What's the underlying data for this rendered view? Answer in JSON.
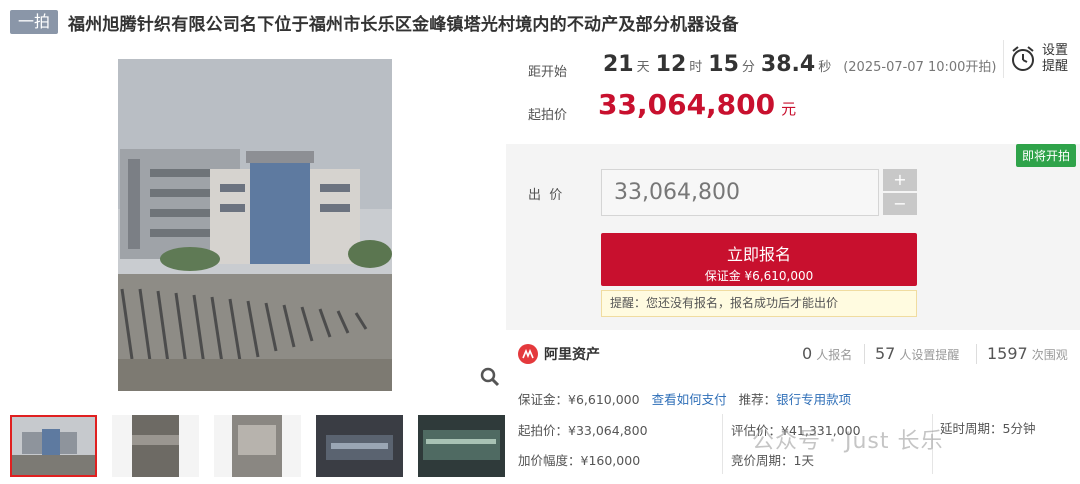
{
  "header": {
    "tag": "一拍",
    "title": "福州旭腾针织有限公司名下位于福州市长乐区金峰镇塔光村境内的不动产及部分机器设备"
  },
  "countdown": {
    "label": "距开始",
    "days": "21",
    "days_unit": "天",
    "hours": "12",
    "hours_unit": "时",
    "minutes": "15",
    "minutes_unit": "分",
    "seconds": "38.4",
    "seconds_unit": "秒",
    "start_note": "(2025-07-07 10:00开拍)"
  },
  "remind": {
    "label": "设置提醒",
    "icon": "alarm-clock-icon"
  },
  "start_price": {
    "label": "起拍价",
    "value": "33,064,800",
    "unit": "元"
  },
  "bid": {
    "soon_badge": "即将开拍",
    "label": "出  价",
    "input_value": "33,064,800",
    "plus": "+",
    "minus": "−",
    "signup_label": "立即报名",
    "deposit_line": "保证金 ¥6,610,000",
    "hint": "提醒：您还没有报名，报名成功后才能出价"
  },
  "platform": {
    "name": "阿里资产",
    "signups": "0",
    "signups_label": "人报名",
    "reminders": "57",
    "reminders_label": "人设置提醒",
    "views": "1597",
    "views_label": "次围观"
  },
  "details": {
    "deposit_label": "保证金：¥6,610,000",
    "pay_link": "查看如何支付",
    "recommend_label": "推荐：",
    "recommend_link": "银行专用款项",
    "start_price_line": "起拍价：¥33,064,800",
    "appraisal_line": "评估价：¥41,331,000",
    "delay_line": "延时周期：5分钟",
    "increment_line": "加价幅度：¥160,000",
    "cycle_line": "竞价周期：1天"
  },
  "watermark": "公众号 · Just 长乐",
  "colors": {
    "accent": "#c8102e",
    "link": "#2f6fb8",
    "badge": "#2fa34a"
  }
}
